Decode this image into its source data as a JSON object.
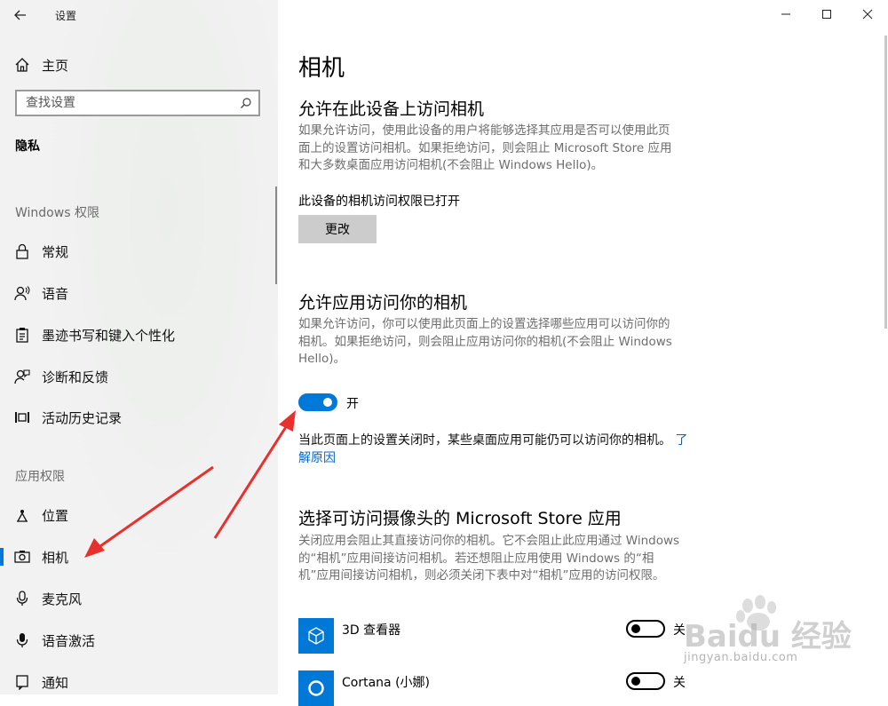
{
  "window": {
    "app_title": "设置",
    "controls": [
      "minimize-icon",
      "maximize-icon",
      "close-icon"
    ]
  },
  "sidebar": {
    "home_label": "主页",
    "search_placeholder": "查找设置",
    "section_title": "隐私",
    "windows_group_title": "Windows 权限",
    "windows_items": [
      {
        "label": "常规",
        "icon": "lock-icon"
      },
      {
        "label": "语音",
        "icon": "speech-icon"
      },
      {
        "label": "墨迹书写和键入个性化",
        "icon": "clipboard-icon"
      },
      {
        "label": "诊断和反馈",
        "icon": "feedback-icon"
      },
      {
        "label": "活动历史记录",
        "icon": "history-icon"
      }
    ],
    "app_group_title": "应用权限",
    "app_items": [
      {
        "label": "位置",
        "icon": "location-icon"
      },
      {
        "label": "相机",
        "icon": "camera-icon",
        "selected": true
      },
      {
        "label": "麦克风",
        "icon": "microphone-icon"
      },
      {
        "label": "语音激活",
        "icon": "voice-activation-icon"
      },
      {
        "label": "通知",
        "icon": "notification-icon"
      }
    ]
  },
  "main": {
    "page_title": "相机",
    "device_section": {
      "heading": "允许在此设备上访问相机",
      "description": "如果允许访问，使用此设备的用户将能够选择其应用是否可以使用此页面上的设置访问相机。如果拒绝访问，则会阻止 Microsoft Store 应用和大多数桌面应用访问相机(不会阻止 Windows Hello)。",
      "status": "此设备的相机访问权限已打开",
      "change_button": "更改"
    },
    "apps_section": {
      "heading": "允许应用访问你的相机",
      "description": "如果允许访问，你可以使用此页面上的设置选择哪些应用可以访问你的相机。如果拒绝访问，则会阻止应用访问你的相机(不会阻止 Windows Hello)。",
      "toggle_label": "开",
      "toggle_on": true,
      "note": "当此页面上的设置关闭时，某些桌面应用可能仍可以访问你的相机。",
      "learn_more": "了解原因"
    },
    "store_section": {
      "heading": "选择可访问摄像头的 Microsoft Store 应用",
      "description": "关闭应用会阻止其直接访问你的相机。它不会阻止此应用通过 Windows 的“相机”应用间接访问相机。若还想阻止应用使用 Windows 的“相机”应用间接访问相机，则必须关闭下表中对“相机”应用的访问权限。",
      "apps": [
        {
          "name": "3D 查看器",
          "icon": "cube-icon",
          "toggle_label": "关",
          "on": false
        },
        {
          "name": "Cortana (小娜)",
          "icon": "cortana-icon",
          "toggle_label": "关",
          "on": false
        }
      ]
    }
  },
  "watermark": {
    "brand": "Baidu 经验",
    "url": "jingyan.baidu.com"
  },
  "colors": {
    "accent": "#0078d7",
    "arrow": "#e8312d",
    "link": "#0066cc"
  }
}
